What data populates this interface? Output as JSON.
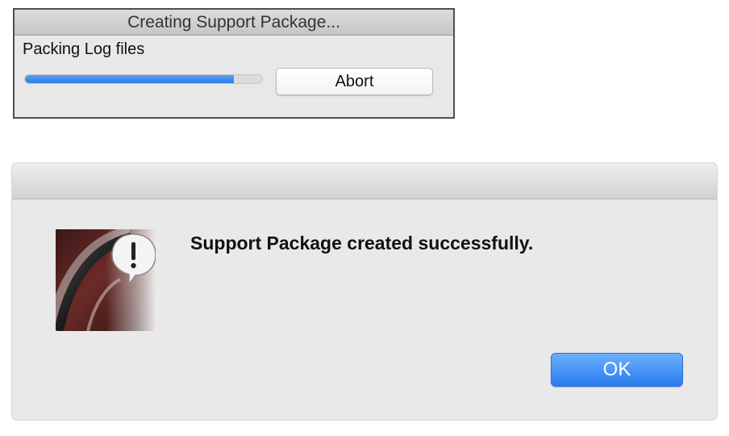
{
  "progress_dialog": {
    "title": "Creating Support Package...",
    "status": "Packing Log files",
    "progress_fraction": 0.88,
    "abort_label": "Abort"
  },
  "alert_dialog": {
    "message": "Support Package created successfully.",
    "icon": "app-alert-icon",
    "ok_label": "OK"
  },
  "colors": {
    "accent_blue": "#2f7be7",
    "ok_button": "#2a7bf0",
    "dialog_background": "#e9e9e9",
    "icon_maroon": "#5a2422"
  }
}
